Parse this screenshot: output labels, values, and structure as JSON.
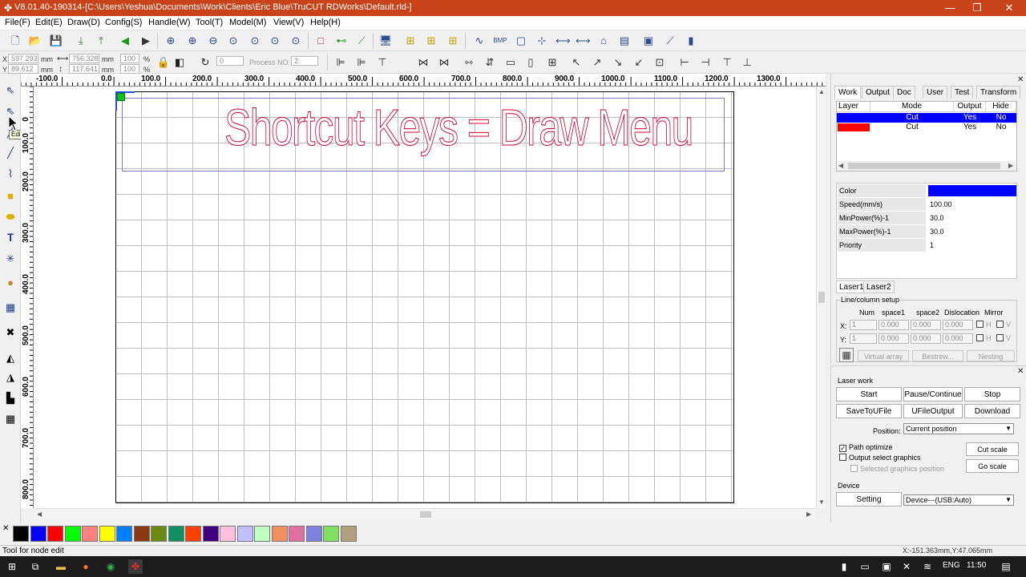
{
  "window": {
    "title": "V8.01.40-190314-[C:\\Users\\Yeshua\\Documents\\Work\\Clients\\Eric Blue\\TruCUT RDWorks\\Default.rld-]",
    "minimize": "—",
    "maximize": "❐",
    "close": "✕"
  },
  "menu": [
    "File(F)",
    "Edit(E)",
    "Draw(D)",
    "Config(S)",
    "Handle(W)",
    "Tool(T)",
    "Model(M)",
    "View(V)",
    "Help(H)"
  ],
  "coords": {
    "x_label": "X",
    "x_value": "597.293",
    "x_unit": "mm",
    "y_label": "Y",
    "y_value": "89.612",
    "y_unit": "mm",
    "w_value": "756.328",
    "w_unit": "mm",
    "h_value": "117.641",
    "h_unit": "mm",
    "sx_value": "100",
    "sx_unit": "%",
    "sy_value": "100",
    "sy_unit": "%",
    "rotate_value": "0",
    "process_label": "Process NO:",
    "process_value": "2"
  },
  "tooltip": "Edit node",
  "ruler_top": [
    "-100.0",
    "0.0",
    "100.0",
    "200.0",
    "300.0",
    "400.0",
    "500.0",
    "600.0",
    "700.0",
    "800.0",
    "900.0",
    "1000.0",
    "1100.0",
    "1200.0",
    "1300.0"
  ],
  "ruler_left": [
    "0",
    "100.0",
    "200.0",
    "300.0",
    "400.0",
    "500.0",
    "600.0",
    "700.0",
    "800.0"
  ],
  "canvas": {
    "text": "Shortcut Keys = Draw Menu",
    "text_color": "#d00030",
    "origin_color": "#17c217"
  },
  "colors": {
    "title_bar": "#c8431a",
    "layer_blue": "#0000ff",
    "layer_red": "#ff0000",
    "palette": [
      "#000000",
      "#0000ff",
      "#ff0000",
      "#00ff00",
      "#ff8080",
      "#ffff00",
      "#0080ff",
      "#8b3a14",
      "#6a8a10",
      "#109060",
      "#ff4000",
      "#400080",
      "#ffc0e0",
      "#c0c0ff",
      "#c0ffc0",
      "#f09060",
      "#e070a0",
      "#8080e0",
      "#80e060",
      "#b0a080"
    ]
  },
  "status": {
    "left": "Tool for node edit",
    "right": "X:-151.363mm,Y:47.065mm"
  },
  "taskbar": {
    "lang": "ENG",
    "time": "11:50"
  },
  "panel": {
    "tabs": [
      "Work",
      "Output",
      "Doc",
      "User",
      "Test",
      "Transform"
    ],
    "layer_headers": [
      "Layer",
      "Mode",
      "Output",
      "Hide"
    ],
    "layers": [
      {
        "color": "#0000ff",
        "mode": "Cut",
        "output": "Yes",
        "hide": "No"
      },
      {
        "color": "#ff0000",
        "mode": "Cut",
        "output": "Yes",
        "hide": "No"
      }
    ],
    "props": [
      {
        "label": "Color",
        "value": ""
      },
      {
        "label": "Speed(mm/s)",
        "value": "100.00"
      },
      {
        "label": "MinPower(%)-1",
        "value": "30.0"
      },
      {
        "label": "MaxPower(%)-1",
        "value": "30.0"
      },
      {
        "label": "Priority",
        "value": "1"
      }
    ],
    "laser_tabs": [
      "Laser1",
      "Laser2"
    ],
    "linecol": {
      "title": "Line/column setup",
      "headers": [
        "Num",
        "space1",
        "space2",
        "Dislocation",
        "Mirror"
      ],
      "x_label": "X:",
      "y_label": "Y:",
      "num": "1",
      "space": "0.000",
      "h": "H",
      "v": "V",
      "buttons": [
        "Virtual array",
        "Bestrew...",
        "Nesting"
      ]
    }
  },
  "laser_work": {
    "title": "Laser work",
    "buttons_row1": [
      "Start",
      "Pause/Continue",
      "Stop"
    ],
    "buttons_row2": [
      "SaveToUFile",
      "UFileOutput",
      "Download"
    ],
    "position_label": "Position:",
    "position_value": "Current position",
    "path_optimize": "Path optimize",
    "output_select": "Output select graphics",
    "selected_pos": "Selected graphics position",
    "cut_scale": "Cut scale",
    "go_scale": "Go scale",
    "device_label": "Device",
    "setting": "Setting",
    "device_value": "Device---(USB:Auto)"
  }
}
